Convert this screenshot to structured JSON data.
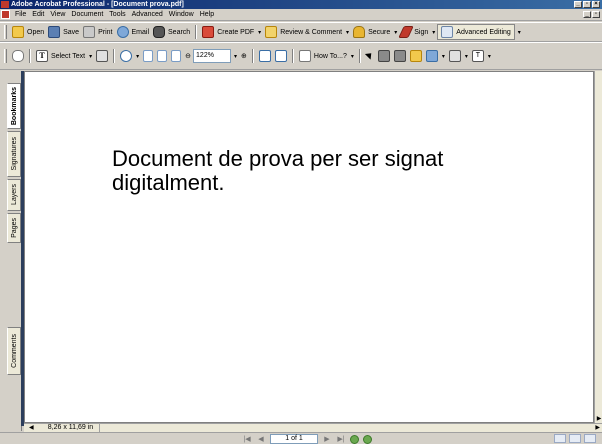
{
  "window": {
    "title": "Adobe Acrobat Professional - [Document prova.pdf]"
  },
  "menu": [
    "File",
    "Edit",
    "View",
    "Document",
    "Tools",
    "Advanced",
    "Window",
    "Help"
  ],
  "toolbar1": {
    "open": "Open",
    "save": "Save",
    "print": "Print",
    "email": "Email",
    "search": "Search",
    "create_pdf": "Create PDF",
    "review": "Review & Comment",
    "secure": "Secure",
    "sign": "Sign",
    "advanced_editing": "Advanced Editing"
  },
  "toolbar2": {
    "select_text": "Select Text",
    "zoom_value": "122%",
    "how_to": "How To...?",
    "measure_glyph": "T"
  },
  "nav_tabs": [
    "Bookmarks",
    "Signatures",
    "Layers",
    "Pages",
    "Comments"
  ],
  "document": {
    "text": "Document de prova per ser signat digitalment."
  },
  "page_size": "8,26 x 11,69 in",
  "status": {
    "page_indicator": "1 of 1"
  },
  "icons": {
    "nav_first": "|◀",
    "nav_prev": "◀",
    "nav_next": "▶",
    "nav_last": "▶|",
    "dropdown": "▾",
    "minimize": "_",
    "maximize": "▫",
    "close": "×",
    "zoom_out": "⊖",
    "zoom_in": "⊕"
  }
}
